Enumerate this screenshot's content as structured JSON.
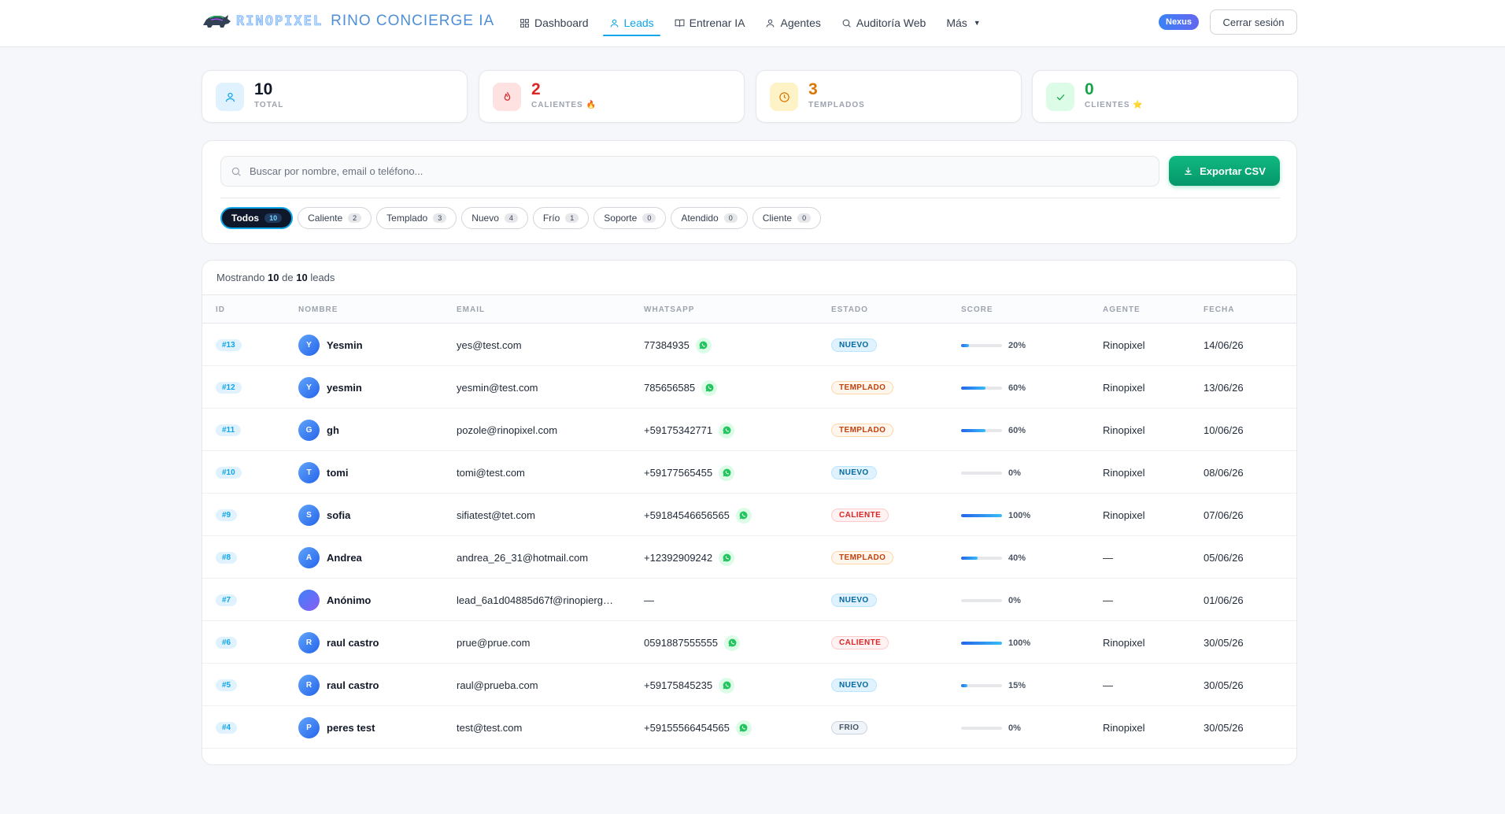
{
  "brand": {
    "wordmark": "RINOPIXEL",
    "name": "RINO CONCIERGE IA"
  },
  "nav": [
    {
      "label": "Dashboard",
      "icon": "grid-icon",
      "active": false
    },
    {
      "label": "Leads",
      "icon": "user-icon",
      "active": true
    },
    {
      "label": "Entrenar IA",
      "icon": "book-icon",
      "active": false
    },
    {
      "label": "Agentes",
      "icon": "person-icon",
      "active": false
    },
    {
      "label": "Auditoría Web",
      "icon": "search-icon",
      "active": false
    },
    {
      "label": "Más",
      "icon": "chevron-down-icon",
      "active": false
    }
  ],
  "header": {
    "badge": "Nexus",
    "logout": "Cerrar sesión"
  },
  "stats": [
    {
      "value": "10",
      "label": "TOTAL",
      "icon": "user-icon",
      "color": "#0ea5e9",
      "bg": "#e0f2fe"
    },
    {
      "value": "2",
      "label": "CALIENTES 🔥",
      "icon": "flame-icon",
      "color": "#dc2626",
      "bg": "#fee2e2"
    },
    {
      "value": "3",
      "label": "TEMPLADOS",
      "icon": "clock-icon",
      "color": "#d97706",
      "bg": "#fef3c7"
    },
    {
      "value": "0",
      "label": "CLIENTES ⭐",
      "icon": "check-icon",
      "color": "#16a34a",
      "bg": "#dcfce7"
    }
  ],
  "search": {
    "placeholder": "Buscar por nombre, email o teléfono...",
    "value": ""
  },
  "export_label": "Exportar CSV",
  "filters": [
    {
      "label": "Todos",
      "count": "10",
      "active": true
    },
    {
      "label": "Caliente",
      "count": "2",
      "active": false
    },
    {
      "label": "Templado",
      "count": "3",
      "active": false
    },
    {
      "label": "Nuevo",
      "count": "4",
      "active": false
    },
    {
      "label": "Frío",
      "count": "1",
      "active": false
    },
    {
      "label": "Soporte",
      "count": "0",
      "active": false
    },
    {
      "label": "Atendido",
      "count": "0",
      "active": false
    },
    {
      "label": "Cliente",
      "count": "0",
      "active": false
    }
  ],
  "showing": {
    "prefix": "Mostrando",
    "shown": "10",
    "mid": "de",
    "total": "10",
    "suffix": "leads"
  },
  "columns": [
    "ID",
    "NOMBRE",
    "EMAIL",
    "WHATSAPP",
    "ESTADO",
    "SCORE",
    "AGENTE",
    "FECHA"
  ],
  "leads": [
    {
      "id": "#13",
      "initial": "Y",
      "name": "Yesmin",
      "email": "yes@test.com",
      "phone": "77384935",
      "status": "NUEVO",
      "status_key": "nuevo",
      "score": 20,
      "score_label": "20%",
      "agent": "Rinopixel",
      "date": "14/06/26"
    },
    {
      "id": "#12",
      "initial": "Y",
      "name": "yesmin",
      "email": "yesmin@test.com",
      "phone": "785656585",
      "status": "TEMPLADO",
      "status_key": "templado",
      "score": 60,
      "score_label": "60%",
      "agent": "Rinopixel",
      "date": "13/06/26"
    },
    {
      "id": "#11",
      "initial": "G",
      "name": "gh",
      "email": "pozole@rinopixel.com",
      "phone": "+59175342771",
      "status": "TEMPLADO",
      "status_key": "templado",
      "score": 60,
      "score_label": "60%",
      "agent": "Rinopixel",
      "date": "10/06/26"
    },
    {
      "id": "#10",
      "initial": "T",
      "name": "tomi",
      "email": "tomi@test.com",
      "phone": "+59177565455",
      "status": "NUEVO",
      "status_key": "nuevo",
      "score": 0,
      "score_label": "0%",
      "agent": "Rinopixel",
      "date": "08/06/26"
    },
    {
      "id": "#9",
      "initial": "S",
      "name": "sofia",
      "email": "sifiatest@tet.com",
      "phone": "+59184546656565",
      "status": "CALIENTE",
      "status_key": "caliente",
      "score": 100,
      "score_label": "100%",
      "agent": "Rinopixel",
      "date": "07/06/26"
    },
    {
      "id": "#8",
      "initial": "A",
      "name": "Andrea",
      "email": "andrea_26_31@hotmail.com",
      "phone": "+12392909242",
      "status": "TEMPLADO",
      "status_key": "templado",
      "score": 40,
      "score_label": "40%",
      "agent": "—",
      "date": "05/06/26"
    },
    {
      "id": "#7",
      "initial": "",
      "name": "Anónimo",
      "email": "lead_6a1d04885d67f@rinopierg…",
      "phone": "—",
      "status": "NUEVO",
      "status_key": "nuevo",
      "score": 0,
      "score_label": "0%",
      "agent": "—",
      "date": "01/06/26"
    },
    {
      "id": "#6",
      "initial": "R",
      "name": "raul castro",
      "email": "prue@prue.com",
      "phone": "0591887555555",
      "status": "CALIENTE",
      "status_key": "caliente",
      "score": 100,
      "score_label": "100%",
      "agent": "Rinopixel",
      "date": "30/05/26"
    },
    {
      "id": "#5",
      "initial": "R",
      "name": "raul castro",
      "email": "raul@prueba.com",
      "phone": "+59175845235",
      "status": "NUEVO",
      "status_key": "nuevo",
      "score": 15,
      "score_label": "15%",
      "agent": "—",
      "date": "30/05/26"
    },
    {
      "id": "#4",
      "initial": "P",
      "name": "peres test",
      "email": "test@test.com",
      "phone": "+59155566454565",
      "status": "FRIO",
      "status_key": "frio",
      "score": 0,
      "score_label": "0%",
      "agent": "Rinopixel",
      "date": "30/05/26"
    }
  ]
}
